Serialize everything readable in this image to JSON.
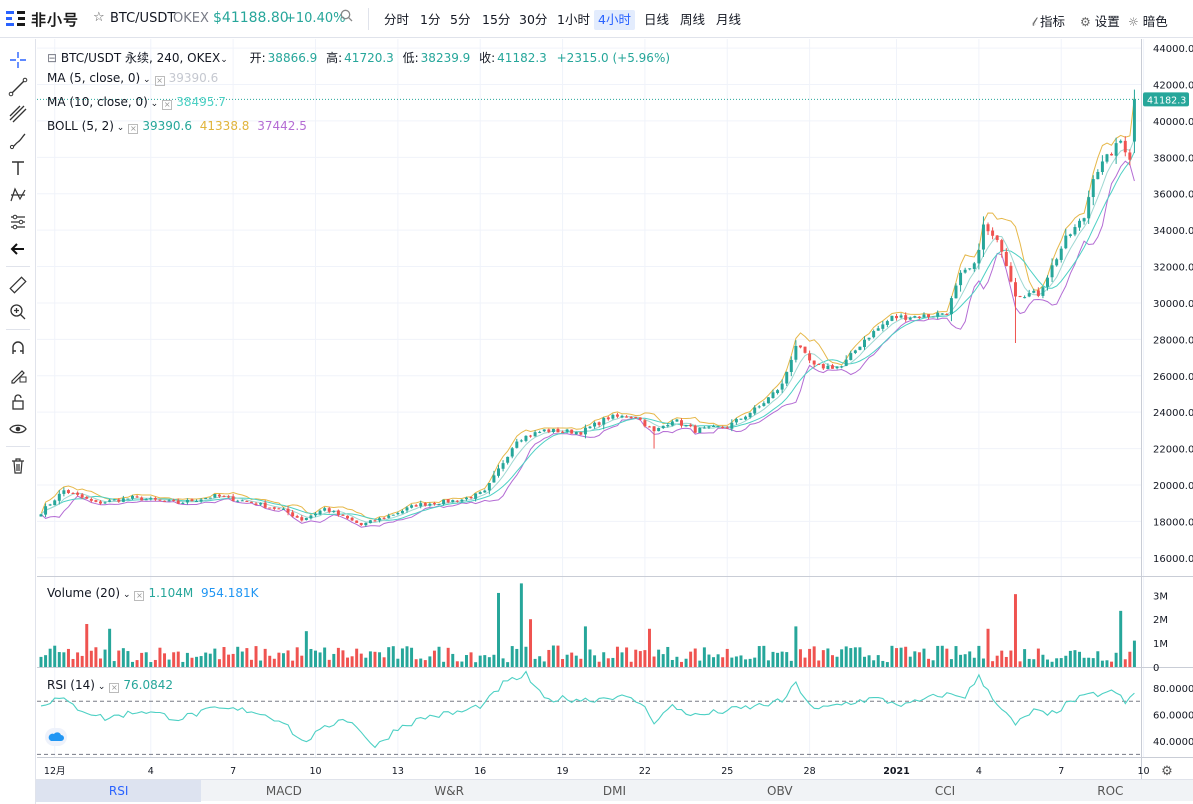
{
  "app": {
    "logo": "非小号",
    "symbol": "BTC/USDT",
    "exchange": "OKEX",
    "price": "$41188.80",
    "change": "+10.40%"
  },
  "timeframes": [
    {
      "label": "分时"
    },
    {
      "label": "1分"
    },
    {
      "label": "5分"
    },
    {
      "label": "15分"
    },
    {
      "label": "30分"
    },
    {
      "label": "1小时"
    },
    {
      "label": "4小时",
      "active": true
    },
    {
      "label": "日线"
    },
    {
      "label": "周线"
    },
    {
      "label": "月线"
    }
  ],
  "toolbar_right": {
    "indicators": "指标",
    "settings": "设置",
    "theme": "暗色"
  },
  "legend": {
    "ohlc": {
      "title": "BTC/USDT 永续, 240, OKEX",
      "open_label": "开:",
      "open": "38866.9",
      "high_label": "高:",
      "high": "41720.3",
      "low_label": "低:",
      "low": "38239.9",
      "close_label": "收:",
      "close": "41182.3",
      "change": "+2315.0 (+5.96%)"
    },
    "ma5": {
      "label": "MA (5, close, 0)",
      "value": "39390.6"
    },
    "ma10": {
      "label": "MA (10, close, 0)",
      "value": "38495.7"
    },
    "boll": {
      "label": "BOLL (5, 2)",
      "mid": "39390.6",
      "upper": "41338.8",
      "lower": "37442.5"
    },
    "volume": {
      "label": "Volume (20)",
      "value": "1.104M",
      "ma": "954.181K"
    },
    "rsi": {
      "label": "RSI (14)",
      "value": "76.0842"
    }
  },
  "bottom_tabs": [
    {
      "label": "RSI",
      "active": true
    },
    {
      "label": "MACD"
    },
    {
      "label": "W&R"
    },
    {
      "label": "DMI"
    },
    {
      "label": "OBV"
    },
    {
      "label": "CCI"
    },
    {
      "label": "ROC"
    }
  ],
  "colors": {
    "up": "#26a69a",
    "down": "#ef5350",
    "accent": "#2962ff",
    "ma5": "#d1d4dc",
    "ma10": "#4dd0c4",
    "boll_mid": "#26a69a",
    "boll_upper": "#e6b84a",
    "boll_lower": "#b46cd4",
    "rsi": "#4dd0c4",
    "grid": "#f0f3fa"
  },
  "chart_data": [
    {
      "type": "candlestick",
      "title": "BTC/USDT 永续, 240, OKEX",
      "ylim": [
        15000,
        44500
      ],
      "y_ticks": [
        16000,
        18000,
        20000,
        22000,
        24000,
        26000,
        28000,
        30000,
        32000,
        34000,
        36000,
        38000,
        40000,
        42000,
        44000
      ],
      "y_tick_labels": [
        "16000.0",
        "18000.0",
        "20000.0",
        "22000.0",
        "24000.0",
        "26000.0",
        "28000.0",
        "30000.0",
        "32000.0",
        "34000.0",
        "36000.0",
        "38000.0",
        "40000.0",
        "42000.0",
        "44000.0"
      ],
      "x_ticks": [
        {
          "label": "12月",
          "bar": 3
        },
        {
          "label": "4",
          "bar": 24
        },
        {
          "label": "7",
          "bar": 42
        },
        {
          "label": "10",
          "bar": 60
        },
        {
          "label": "13",
          "bar": 78
        },
        {
          "label": "16",
          "bar": 96
        },
        {
          "label": "19",
          "bar": 114
        },
        {
          "label": "22",
          "bar": 132
        },
        {
          "label": "25",
          "bar": 150
        },
        {
          "label": "28",
          "bar": 168
        },
        {
          "label": "2021",
          "bar": 187
        },
        {
          "label": "4",
          "bar": 205
        },
        {
          "label": "7",
          "bar": 223
        },
        {
          "label": "10",
          "bar": 241
        }
      ],
      "last_price": "41182.3",
      "close_anchors": [
        [
          0,
          18500
        ],
        [
          5,
          19700
        ],
        [
          12,
          19000
        ],
        [
          20,
          19300
        ],
        [
          30,
          19000
        ],
        [
          38,
          19400
        ],
        [
          45,
          19100
        ],
        [
          53,
          18600
        ],
        [
          57,
          18100
        ],
        [
          62,
          18700
        ],
        [
          70,
          17800
        ],
        [
          76,
          18300
        ],
        [
          82,
          18900
        ],
        [
          92,
          19200
        ],
        [
          97,
          19600
        ],
        [
          104,
          22500
        ],
        [
          110,
          23000
        ],
        [
          118,
          22900
        ],
        [
          124,
          23700
        ],
        [
          130,
          23800
        ],
        [
          134,
          22900
        ],
        [
          138,
          23600
        ],
        [
          143,
          23000
        ],
        [
          150,
          23200
        ],
        [
          157,
          24300
        ],
        [
          162,
          25500
        ],
        [
          165,
          27700
        ],
        [
          169,
          26500
        ],
        [
          175,
          26500
        ],
        [
          180,
          28000
        ],
        [
          186,
          29200
        ],
        [
          194,
          29300
        ],
        [
          198,
          29500
        ],
        [
          201,
          31500
        ],
        [
          204,
          32000
        ],
        [
          206,
          34200
        ],
        [
          210,
          33000
        ],
        [
          213,
          30500
        ],
        [
          218,
          30500
        ],
        [
          221,
          32000
        ],
        [
          224,
          33500
        ],
        [
          228,
          34700
        ],
        [
          230,
          37000
        ],
        [
          236,
          38900
        ],
        [
          238,
          38000
        ],
        [
          239,
          41182
        ]
      ],
      "ohlc_last": {
        "open": 38866.9,
        "high": 41720.3,
        "low": 38239.9,
        "close": 41182.3
      },
      "wicks": [
        {
          "bar": 213,
          "low": 27800
        },
        {
          "bar": 134,
          "low": 22000
        }
      ],
      "ma5_last": 39390.6,
      "ma10_last": 38495.7,
      "boll": {
        "mid": 39390.6,
        "upper": 41338.8,
        "lower": 37442.5
      }
    },
    {
      "type": "bar",
      "title": "Volume (20)",
      "ylim": [
        0,
        3600000
      ],
      "y_ticks": [
        0,
        1000000,
        2000000,
        3000000
      ],
      "y_tick_labels": [
        "0",
        "1M",
        "2M",
        "3M"
      ],
      "last": 1104000,
      "ma": 954181,
      "spikes": [
        {
          "bar": 10,
          "value": 1800000
        },
        {
          "bar": 15,
          "value": 1600000
        },
        {
          "bar": 58,
          "value": 1500000
        },
        {
          "bar": 100,
          "value": 3100000
        },
        {
          "bar": 105,
          "value": 3500000
        },
        {
          "bar": 107,
          "value": 2000000
        },
        {
          "bar": 119,
          "value": 1700000
        },
        {
          "bar": 133,
          "value": 1600000
        },
        {
          "bar": 165,
          "value": 1700000
        },
        {
          "bar": 207,
          "value": 1600000
        },
        {
          "bar": 213,
          "value": 3050000
        },
        {
          "bar": 236,
          "value": 2350000
        }
      ]
    },
    {
      "type": "line",
      "title": "RSI (14)",
      "ylim": [
        28,
        95
      ],
      "y_ticks": [
        40,
        60,
        80
      ],
      "y_tick_labels": [
        "40.0000",
        "60.0000",
        "80.0000"
      ],
      "bands": [
        30,
        70
      ],
      "last": 76.0842,
      "anchors": [
        [
          0,
          68
        ],
        [
          4,
          72
        ],
        [
          8,
          65
        ],
        [
          14,
          57
        ],
        [
          22,
          63
        ],
        [
          30,
          57
        ],
        [
          38,
          64
        ],
        [
          46,
          63
        ],
        [
          53,
          55
        ],
        [
          57,
          39
        ],
        [
          61,
          47
        ],
        [
          66,
          58
        ],
        [
          70,
          48
        ],
        [
          73,
          35
        ],
        [
          78,
          50
        ],
        [
          84,
          58
        ],
        [
          92,
          62
        ],
        [
          97,
          68
        ],
        [
          101,
          83
        ],
        [
          106,
          90
        ],
        [
          110,
          71
        ],
        [
          114,
          72
        ],
        [
          120,
          71
        ],
        [
          126,
          74
        ],
        [
          131,
          69
        ],
        [
          134,
          55
        ],
        [
          138,
          66
        ],
        [
          143,
          59
        ],
        [
          150,
          63
        ],
        [
          156,
          66
        ],
        [
          162,
          70
        ],
        [
          165,
          83
        ],
        [
          169,
          63
        ],
        [
          175,
          68
        ],
        [
          182,
          72
        ],
        [
          189,
          67
        ],
        [
          197,
          75
        ],
        [
          202,
          74
        ],
        [
          205,
          88
        ],
        [
          210,
          64
        ],
        [
          213,
          52
        ],
        [
          217,
          63
        ],
        [
          220,
          59
        ],
        [
          226,
          71
        ],
        [
          230,
          75
        ],
        [
          235,
          77
        ],
        [
          237,
          68
        ],
        [
          239,
          76
        ]
      ]
    }
  ]
}
